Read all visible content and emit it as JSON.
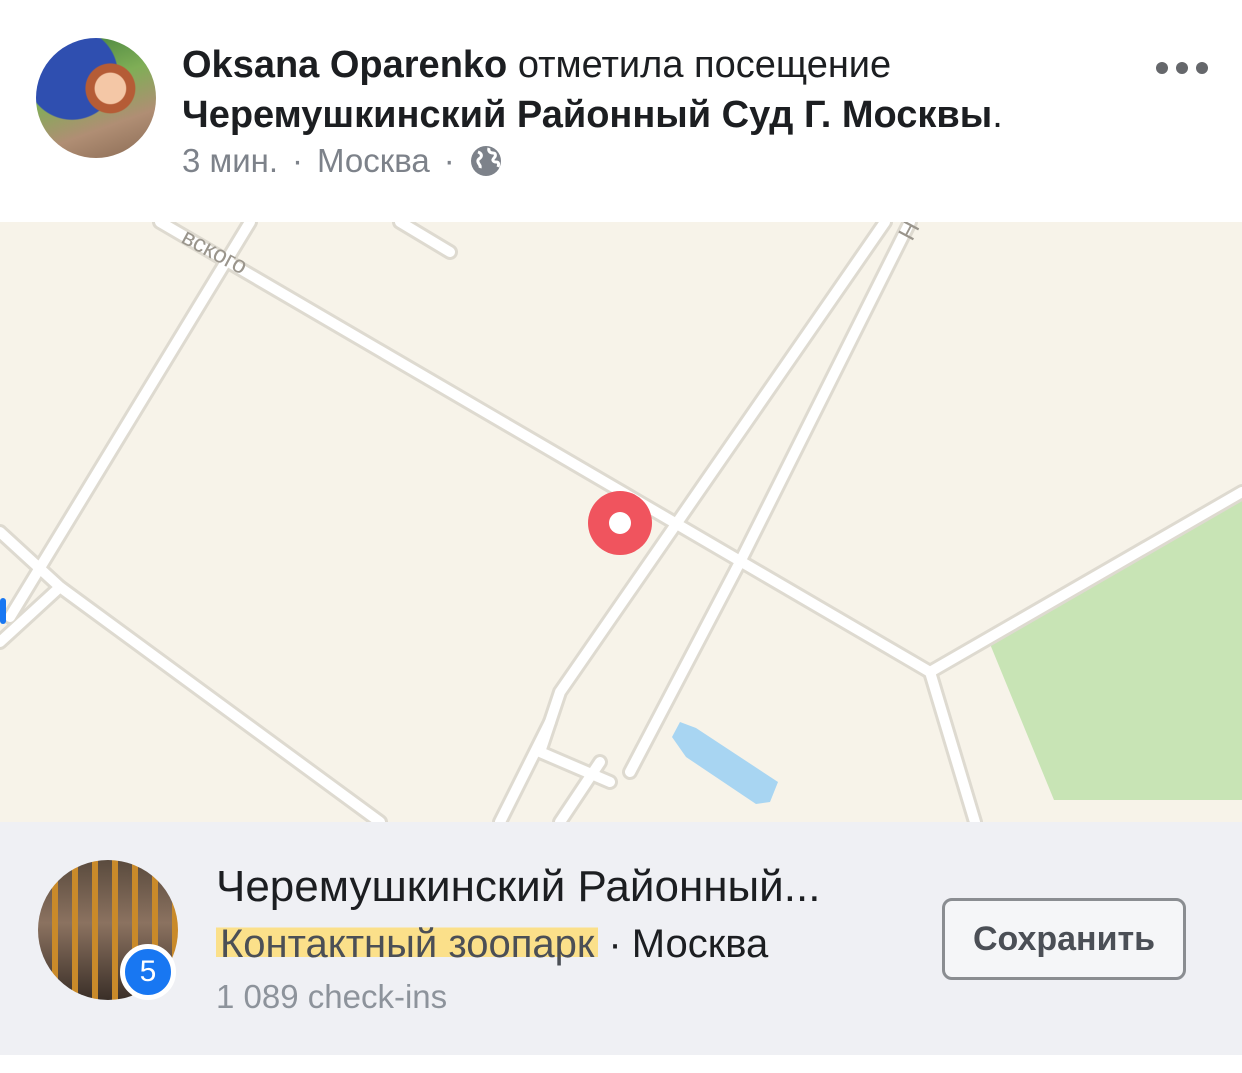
{
  "post": {
    "author": "Oksana Oparenko",
    "action": "отметила посещение",
    "place_name": "Черемушкинский Районный Суд Г. Москвы",
    "period": ".",
    "time": "3 мин.",
    "dot": "·",
    "location": "Москва",
    "privacy_icon": "globe-icon",
    "more_icon": "more-icon"
  },
  "map": {
    "street_label_1": "вского",
    "street_label_2": "Н",
    "pin_icon": "map-pin-icon",
    "colors": {
      "background": "#f7f3e9",
      "road": "#ffffff",
      "road_edge": "#dedad0",
      "park": "#c8e4b5",
      "water": "#a8d5f2",
      "pin": "#f0545e"
    }
  },
  "place_card": {
    "title": "Черемушкинский Районный...",
    "category": "Контактный зоопарк",
    "dot": "·",
    "city": "Москва",
    "checkins": "1 089 check-ins",
    "badge_count": "5",
    "save_label": "Сохранить"
  }
}
